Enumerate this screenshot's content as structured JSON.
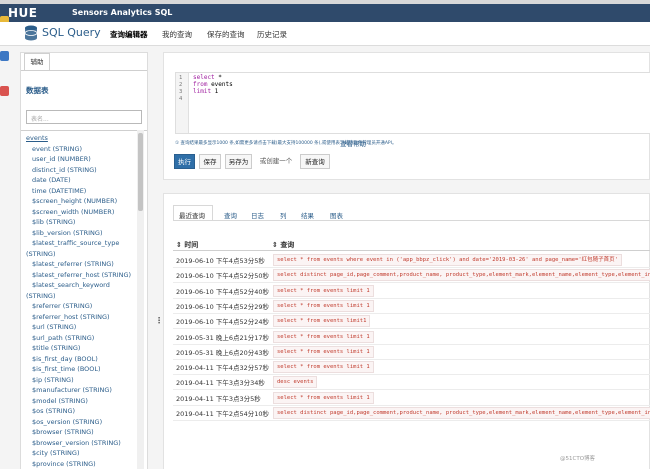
{
  "navbar": {
    "logo": "HUE",
    "brand": "Sensors Analytics SQL"
  },
  "subnav": {
    "title": "SQL Query",
    "tabs": [
      {
        "label": "查询编辑器",
        "active": true
      },
      {
        "label": "我的查询",
        "active": false
      },
      {
        "label": "保存的查询",
        "active": false
      },
      {
        "label": "历史记录",
        "active": false
      }
    ]
  },
  "sidebar": {
    "tab_label": "辅助",
    "title": "数据表",
    "search_placeholder": "表名...",
    "items": [
      {
        "text": "events",
        "type": "table"
      },
      {
        "text": "event (STRING)",
        "type": "field"
      },
      {
        "text": "user_id (NUMBER)",
        "type": "field"
      },
      {
        "text": "distinct_id (STRING)",
        "type": "field"
      },
      {
        "text": "date (DATE)",
        "type": "field"
      },
      {
        "text": "time (DATETIME)",
        "type": "field"
      },
      {
        "text": "$screen_height (NUMBER)",
        "type": "field"
      },
      {
        "text": "$screen_width (NUMBER)",
        "type": "field"
      },
      {
        "text": "$lib (STRING)",
        "type": "field"
      },
      {
        "text": "$lib_version (STRING)",
        "type": "field"
      },
      {
        "text": "$latest_traffic_source_type",
        "type": "field"
      },
      {
        "text": "(STRING)",
        "type": "wrap"
      },
      {
        "text": "$latest_referrer (STRING)",
        "type": "field"
      },
      {
        "text": "$latest_referrer_host (STRING)",
        "type": "field"
      },
      {
        "text": "$latest_search_keyword",
        "type": "field"
      },
      {
        "text": "(STRING)",
        "type": "wrap"
      },
      {
        "text": "$referrer (STRING)",
        "type": "field"
      },
      {
        "text": "$referrer_host (STRING)",
        "type": "field"
      },
      {
        "text": "$url (STRING)",
        "type": "field"
      },
      {
        "text": "$url_path (STRING)",
        "type": "field"
      },
      {
        "text": "$title (STRING)",
        "type": "field"
      },
      {
        "text": "$is_first_day (BOOL)",
        "type": "field"
      },
      {
        "text": "$is_first_time (BOOL)",
        "type": "field"
      },
      {
        "text": "$ip (STRING)",
        "type": "field"
      },
      {
        "text": "$manufacturer (STRING)",
        "type": "field"
      },
      {
        "text": "$model (STRING)",
        "type": "field"
      },
      {
        "text": "$os (STRING)",
        "type": "field"
      },
      {
        "text": "$os_version (STRING)",
        "type": "field"
      },
      {
        "text": "$browser (STRING)",
        "type": "field"
      },
      {
        "text": "$browser_version (STRING)",
        "type": "field"
      },
      {
        "text": "$city (STRING)",
        "type": "field"
      },
      {
        "text": "$province (STRING)",
        "type": "field"
      }
    ]
  },
  "editor": {
    "line_numbers": [
      "1",
      "2",
      "3",
      "4"
    ],
    "lines": [
      {
        "kw": "select",
        "rest": " *"
      },
      {
        "kw": "from",
        "rest": " events"
      },
      {
        "kw": "limit",
        "rest": " 1"
      },
      {
        "kw": "",
        "rest": ""
      }
    ],
    "hint": "① 查询结果最多显示1000 条,如需更多请点击下载(最大支持100000 条),或使用表下载请联系管理员开通API。",
    "help_link": "查看帮助"
  },
  "actions": {
    "execute": "执行",
    "save": "保存",
    "save_as": "另存为",
    "or_create": "或创建一个",
    "new_query": "新查询"
  },
  "history": {
    "tabs": [
      "最近查询",
      "查询",
      "日志",
      "列",
      "结果",
      "图表"
    ],
    "col_time": "时间",
    "col_query": "查询",
    "rows": [
      {
        "time": "2019-06-10 下午4点53分5秒",
        "sql": "select * from events where event in ('app_bbpz_click') and date='2019-03-26' and page_name='红包随子首页'"
      },
      {
        "time": "2019-06-10 下午4点52分50秒",
        "sql": "select distinct page_id,page_comment,product_name, product_type,element_mark,element_name,element_type,element_index f"
      },
      {
        "time": "2019-06-10 下午4点52分40秒",
        "sql": "select * from events limit 1"
      },
      {
        "time": "2019-06-10 下午4点52分29秒",
        "sql": "select * from events limit 1"
      },
      {
        "time": "2019-06-10 下午4点52分24秒",
        "sql": "select * from events limit1"
      },
      {
        "time": "2019-05-31 晚上6点21分17秒",
        "sql": "select * from events limit 1"
      },
      {
        "time": "2019-05-31 晚上6点20分43秒",
        "sql": "select * from events limit 1"
      },
      {
        "time": "2019-04-11 下午4点32分57秒",
        "sql": "select * from events limit 1"
      },
      {
        "time": "2019-04-11 下午3点3分34秒",
        "sql": "desc events"
      },
      {
        "time": "2019-04-11 下午3点3分5秒",
        "sql": "select * from events limit 1"
      },
      {
        "time": "2019-04-11 下午2点54分10秒",
        "sql": "select distinct page_id,page_comment,product_name, product_type,element_mark,element_name,element_type,element_index f"
      }
    ]
  },
  "watermark": "@51CTO博客",
  "colors": {
    "navbar": "#2f4a6b",
    "accent": "#2b5d8a",
    "primary_button": "#2f6fa8",
    "sql_text": "#c0392b"
  }
}
